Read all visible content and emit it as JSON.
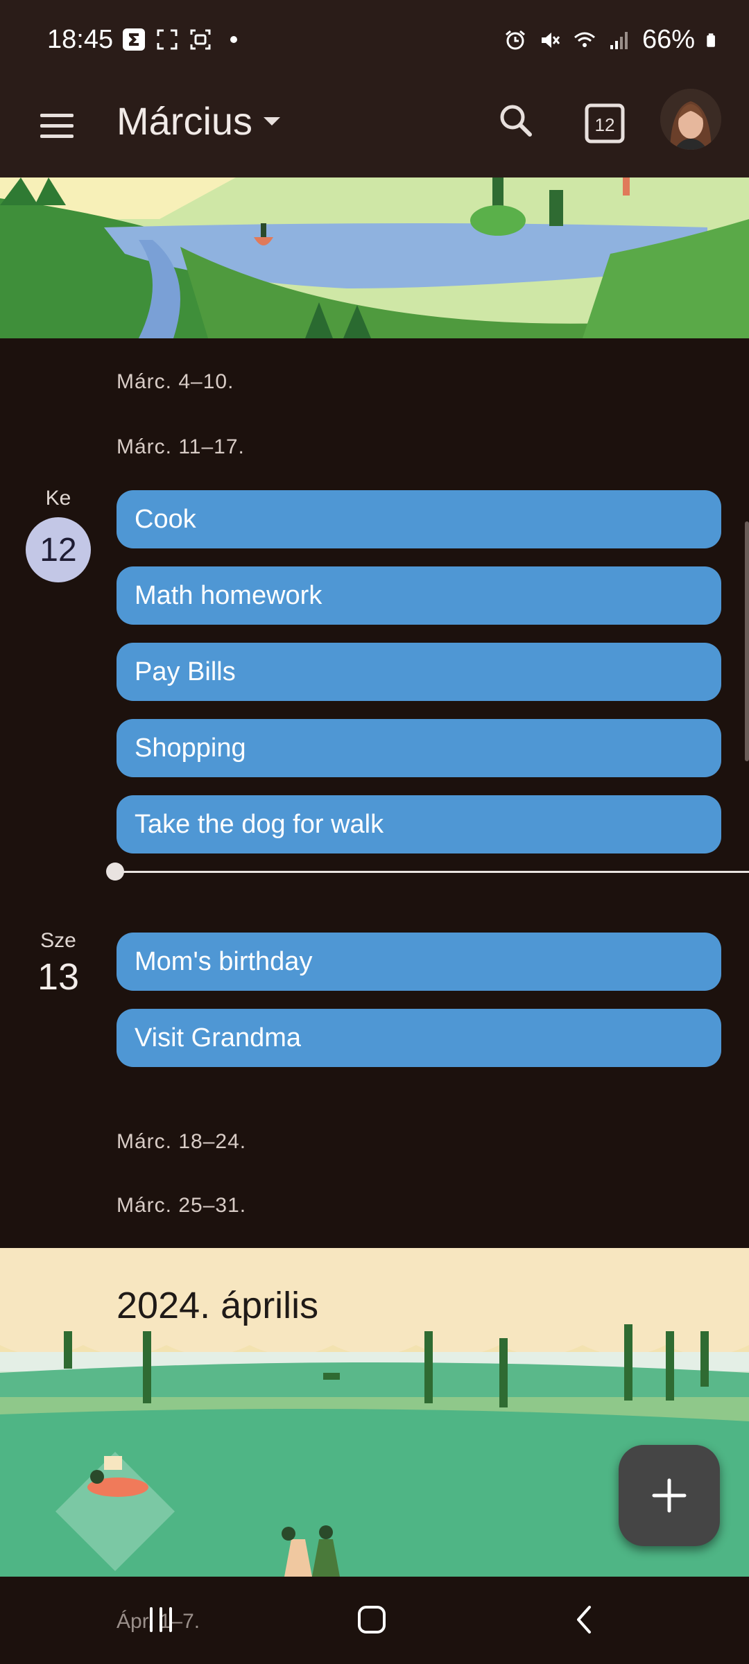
{
  "status_bar": {
    "time": "18:45",
    "battery": "66%",
    "icons": [
      "sigma-app-icon",
      "screenshot-icon",
      "screen-record-icon",
      "dot-icon",
      "alarm-icon",
      "mute-icon",
      "wifi-icon",
      "signal-icon",
      "battery-icon"
    ]
  },
  "app_bar": {
    "title": "Március",
    "today_day": "12"
  },
  "weeks": {
    "w1": "Márc. 4–10.",
    "w2": "Márc. 11–17.",
    "w3": "Márc. 18–24.",
    "w4": "Márc. 25–31."
  },
  "days": [
    {
      "dow": "Ke",
      "num": "12",
      "events": [
        "Cook",
        "Math homework",
        "Pay Bills",
        "Shopping",
        "Take the dog for walk"
      ]
    },
    {
      "dow": "Sze",
      "num": "13",
      "events": [
        "Mom's birthday",
        "Visit Grandma"
      ]
    }
  ],
  "next_month": {
    "title": "2024. április",
    "peek_label": "Ápr. 1–7."
  },
  "colors": {
    "event": "#4f97d4",
    "background": "#1c110d",
    "app_bar": "#2a1c18",
    "today_circle": "#c3c7e6",
    "fab": "#454545"
  }
}
